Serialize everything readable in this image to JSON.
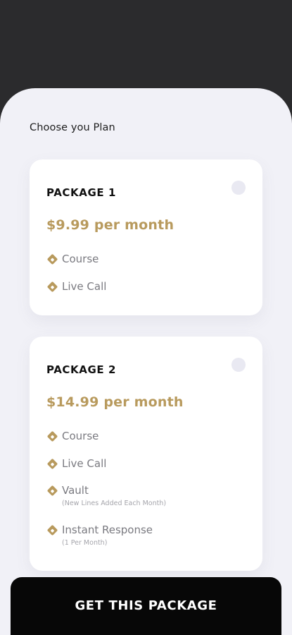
{
  "page": {
    "heading": "Choose you Plan"
  },
  "packages": [
    {
      "name": "PACKAGE 1",
      "price": "$9.99 per month",
      "features": [
        {
          "label": "Course",
          "sub": ""
        },
        {
          "label": "Live Call",
          "sub": ""
        }
      ]
    },
    {
      "name": "PACKAGE 2",
      "price": "$14.99 per month",
      "features": [
        {
          "label": "Course",
          "sub": ""
        },
        {
          "label": "Live Call",
          "sub": ""
        },
        {
          "label": "Vault",
          "sub": "(New Lines Added Each Month)"
        },
        {
          "label": "Instant Response",
          "sub": "(1 Per Month)"
        }
      ]
    }
  ],
  "cta": {
    "label": "GET THIS PACKAGE"
  },
  "colors": {
    "accent": "#b89a5d",
    "background_top": "#2b2b2d",
    "sheet": "#f1f1f7",
    "button": "#070707"
  },
  "icons": {
    "feature_bullet": "diamond-icon",
    "package_select": "radio-button"
  }
}
